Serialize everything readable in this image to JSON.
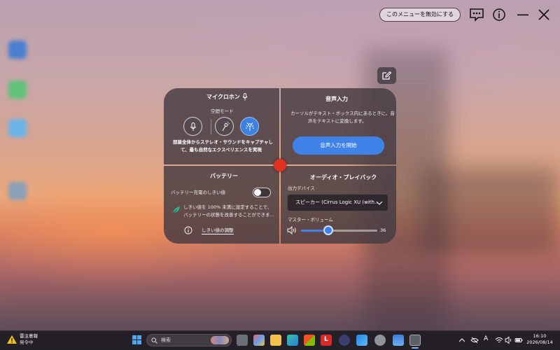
{
  "topbar": {
    "disable_menu_label": "このメニューを無効にする"
  },
  "microphone": {
    "title": "マイクロホン",
    "mode_label": "空間モード",
    "description_line1": "部屋全体からステレオ・サウンドをキャプチャし",
    "description_line2": "て、最も自然なエクスペリエンスを実現",
    "selected_mode": "room"
  },
  "voice_input": {
    "title": "音声入力",
    "description_line1": "カーソルがテキスト・ボックス内にあるときに、音",
    "description_line2": "声をテキストに変換します。",
    "start_button": "音声入力を開始"
  },
  "battery": {
    "title": "バッテリー",
    "threshold_label": "バッテリー充電のしきい値",
    "threshold_enabled": false,
    "tip_line1": "しきい値を 100% 未満に設定することで、",
    "tip_line2": "バッテリーの状態を改善することができま...",
    "adjust_link": "しきい値の調整"
  },
  "audio": {
    "title": "オーディオ・プレイバック",
    "output_label": "出力デバイス",
    "output_device": "スピーカー (Cirrus Logic XU (with...",
    "volume_label": "マスター・ボリューム",
    "volume_value": "36",
    "volume_level": 0.36,
    "accent_color": "#3f82e8"
  },
  "taskbar": {
    "weather_line1": "雷注意報",
    "weather_line2": "発令中",
    "search_placeholder": "検索",
    "ime_indicator": "A",
    "time": "16:10",
    "date": "2026/08/14"
  }
}
